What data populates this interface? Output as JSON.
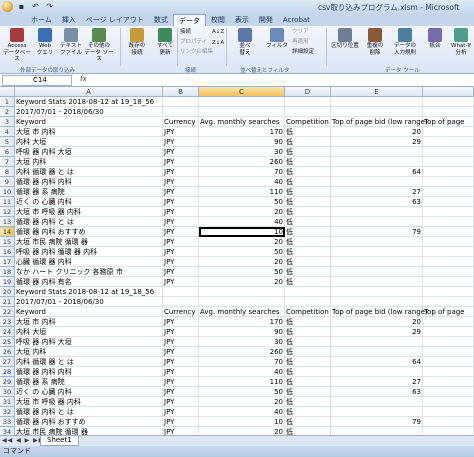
{
  "window": {
    "title": "csv取り込みプログラム.xlsm - Microsoft"
  },
  "tabs": [
    "ホーム",
    "挿入",
    "ページ レイアウト",
    "数式",
    "データ",
    "校閲",
    "表示",
    "開発",
    "Acrobat"
  ],
  "active_tab_index": 4,
  "ribbon": {
    "buttons": [
      {
        "label": "Access\nデータベース",
        "color": "#a33c3c"
      },
      {
        "label": "Web\nクエリ",
        "color": "#3c6fb4"
      },
      {
        "label": "テキスト\nファイル",
        "color": "#7a8fa8"
      },
      {
        "label": "その他の\nデータ ソース",
        "color": "#5b8a4e"
      },
      {
        "label": "既存の\n接続",
        "color": "#c79a3a"
      },
      {
        "label": "すべて\n更新",
        "color": "#3f8a5a"
      },
      {
        "label": "並べ\n替え",
        "color": "#5a78a8"
      },
      {
        "label": "フィルタ",
        "color": "#6a8ab8"
      },
      {
        "label": "区切り位置",
        "color": "#6f7f94"
      },
      {
        "label": "重複の\n削除",
        "color": "#8a5a3a"
      },
      {
        "label": "データの\n入力規則",
        "color": "#4e7e9e"
      },
      {
        "label": "統合",
        "color": "#7a6aa8"
      },
      {
        "label": "What-If\n分析",
        "color": "#4e9e8e"
      }
    ],
    "small_items": [
      "接続",
      "プロパティ",
      "リンクの編集",
      "クリア",
      "再適用",
      "詳細設定"
    ],
    "sort_az": "A↓Z",
    "sort_za": "Z↓A",
    "groups": [
      "外部データの取り込み",
      "接続",
      "並べ替えとフィルタ",
      "データ ツール"
    ]
  },
  "formula_bar": {
    "name_box": "C14",
    "fx": "fx",
    "value": ""
  },
  "columns": [
    {
      "letter": "A",
      "width": 148
    },
    {
      "letter": "B",
      "width": 36
    },
    {
      "letter": "C",
      "width": 86
    },
    {
      "letter": "D",
      "width": 46
    },
    {
      "letter": "E",
      "width": 92
    },
    {
      "letter": "",
      "width": 51
    }
  ],
  "selected_column": "C",
  "selected_row": 14,
  "rows": [
    {
      "n": 1,
      "c": [
        "Keyword Stats 2018-08-12 at 19_18_56",
        "",
        "",
        "",
        "",
        ""
      ]
    },
    {
      "n": 2,
      "c": [
        "2017/07/01 - 2018/06/30",
        "",
        "",
        "",
        "",
        ""
      ]
    },
    {
      "n": 3,
      "c": [
        "Keyword",
        "Currency",
        "Avg. monthly searches",
        "Competition",
        "Top of page bid (low range)",
        "Top of page"
      ]
    },
    {
      "n": 4,
      "c": [
        "大垣 市 内科",
        "JPY",
        "170",
        "低",
        "20",
        ""
      ]
    },
    {
      "n": 5,
      "c": [
        "内科 大垣",
        "JPY",
        "90",
        "低",
        "29",
        ""
      ]
    },
    {
      "n": 6,
      "c": [
        "呼吸 器 内科 大垣",
        "JPY",
        "30",
        "低",
        "",
        ""
      ]
    },
    {
      "n": 7,
      "c": [
        "大垣 内科",
        "JPY",
        "260",
        "低",
        "",
        ""
      ]
    },
    {
      "n": 8,
      "c": [
        "内科 循環 器 と は",
        "JPY",
        "70",
        "低",
        "64",
        ""
      ]
    },
    {
      "n": 9,
      "c": [
        "循環 器 内科 内科",
        "JPY",
        "40",
        "低",
        "",
        ""
      ]
    },
    {
      "n": 10,
      "c": [
        "循環 器 系 病院",
        "JPY",
        "110",
        "低",
        "27",
        ""
      ]
    },
    {
      "n": 11,
      "c": [
        "近く の 心臓 内科",
        "JPY",
        "50",
        "低",
        "63",
        ""
      ]
    },
    {
      "n": 12,
      "c": [
        "大垣 市 呼吸 器 内科",
        "JPY",
        "20",
        "低",
        "",
        ""
      ]
    },
    {
      "n": 13,
      "c": [
        "循環 器 内科 と は",
        "JPY",
        "40",
        "低",
        "",
        ""
      ]
    },
    {
      "n": 14,
      "c": [
        "循環 器 内科 おすすめ",
        "JPY",
        "10",
        "低",
        "79",
        ""
      ]
    },
    {
      "n": 15,
      "c": [
        "大垣 市民 病院 循環 器",
        "JPY",
        "20",
        "低",
        "",
        ""
      ]
    },
    {
      "n": 16,
      "c": [
        "呼吸 器 内科 循環 器 内科",
        "JPY",
        "50",
        "低",
        "",
        ""
      ]
    },
    {
      "n": 17,
      "c": [
        "心臓 循環 器 内科",
        "JPY",
        "20",
        "低",
        "",
        ""
      ]
    },
    {
      "n": 18,
      "c": [
        "なか ハート クリニック 各務原 市",
        "JPY",
        "50",
        "低",
        "",
        ""
      ]
    },
    {
      "n": 19,
      "c": [
        "循環 器 内科 有名",
        "JPY",
        "20",
        "低",
        "",
        ""
      ]
    },
    {
      "n": 20,
      "c": [
        "Keyword Stats 2018-08-12 at 19_18_56",
        "",
        "",
        "",
        "",
        ""
      ]
    },
    {
      "n": 21,
      "c": [
        "2017/07/01 - 2018/06/30",
        "",
        "",
        "",
        "",
        ""
      ]
    },
    {
      "n": 22,
      "c": [
        "Keyword",
        "Currency",
        "Avg. monthly searches",
        "Competition",
        "Top of page bid (low range)",
        "Top of page"
      ]
    },
    {
      "n": 23,
      "c": [
        "大垣 市 内科",
        "JPY",
        "170",
        "低",
        "20",
        ""
      ]
    },
    {
      "n": 24,
      "c": [
        "内科 大垣",
        "JPY",
        "90",
        "低",
        "29",
        ""
      ]
    },
    {
      "n": 25,
      "c": [
        "呼吸 器 内科 大垣",
        "JPY",
        "30",
        "低",
        "",
        ""
      ]
    },
    {
      "n": 26,
      "c": [
        "大垣 内科",
        "JPY",
        "260",
        "低",
        "",
        ""
      ]
    },
    {
      "n": 27,
      "c": [
        "内科 循環 器 と は",
        "JPY",
        "70",
        "低",
        "64",
        ""
      ]
    },
    {
      "n": 28,
      "c": [
        "循環 器 内科 内科",
        "JPY",
        "40",
        "低",
        "",
        ""
      ]
    },
    {
      "n": 29,
      "c": [
        "循環 器 系 病院",
        "JPY",
        "110",
        "低",
        "27",
        ""
      ]
    },
    {
      "n": 30,
      "c": [
        "近く の 心臓 内科",
        "JPY",
        "50",
        "低",
        "63",
        ""
      ]
    },
    {
      "n": 31,
      "c": [
        "大垣 市 呼吸 器 内科",
        "JPY",
        "20",
        "低",
        "",
        ""
      ]
    },
    {
      "n": 32,
      "c": [
        "循環 器 内科 と は",
        "JPY",
        "40",
        "低",
        "",
        ""
      ]
    },
    {
      "n": 33,
      "c": [
        "循環 器 内科 おすすめ",
        "JPY",
        "10",
        "低",
        "79",
        ""
      ]
    },
    {
      "n": 34,
      "c": [
        "大垣 市民 病院 循環 器",
        "JPY",
        "20",
        "低",
        "",
        ""
      ]
    }
  ],
  "sheet_tabs": {
    "nav": "◀◀ ◀ ▶ ▶▶",
    "active": "Sheet1"
  },
  "status": {
    "mode": "コマンド"
  }
}
